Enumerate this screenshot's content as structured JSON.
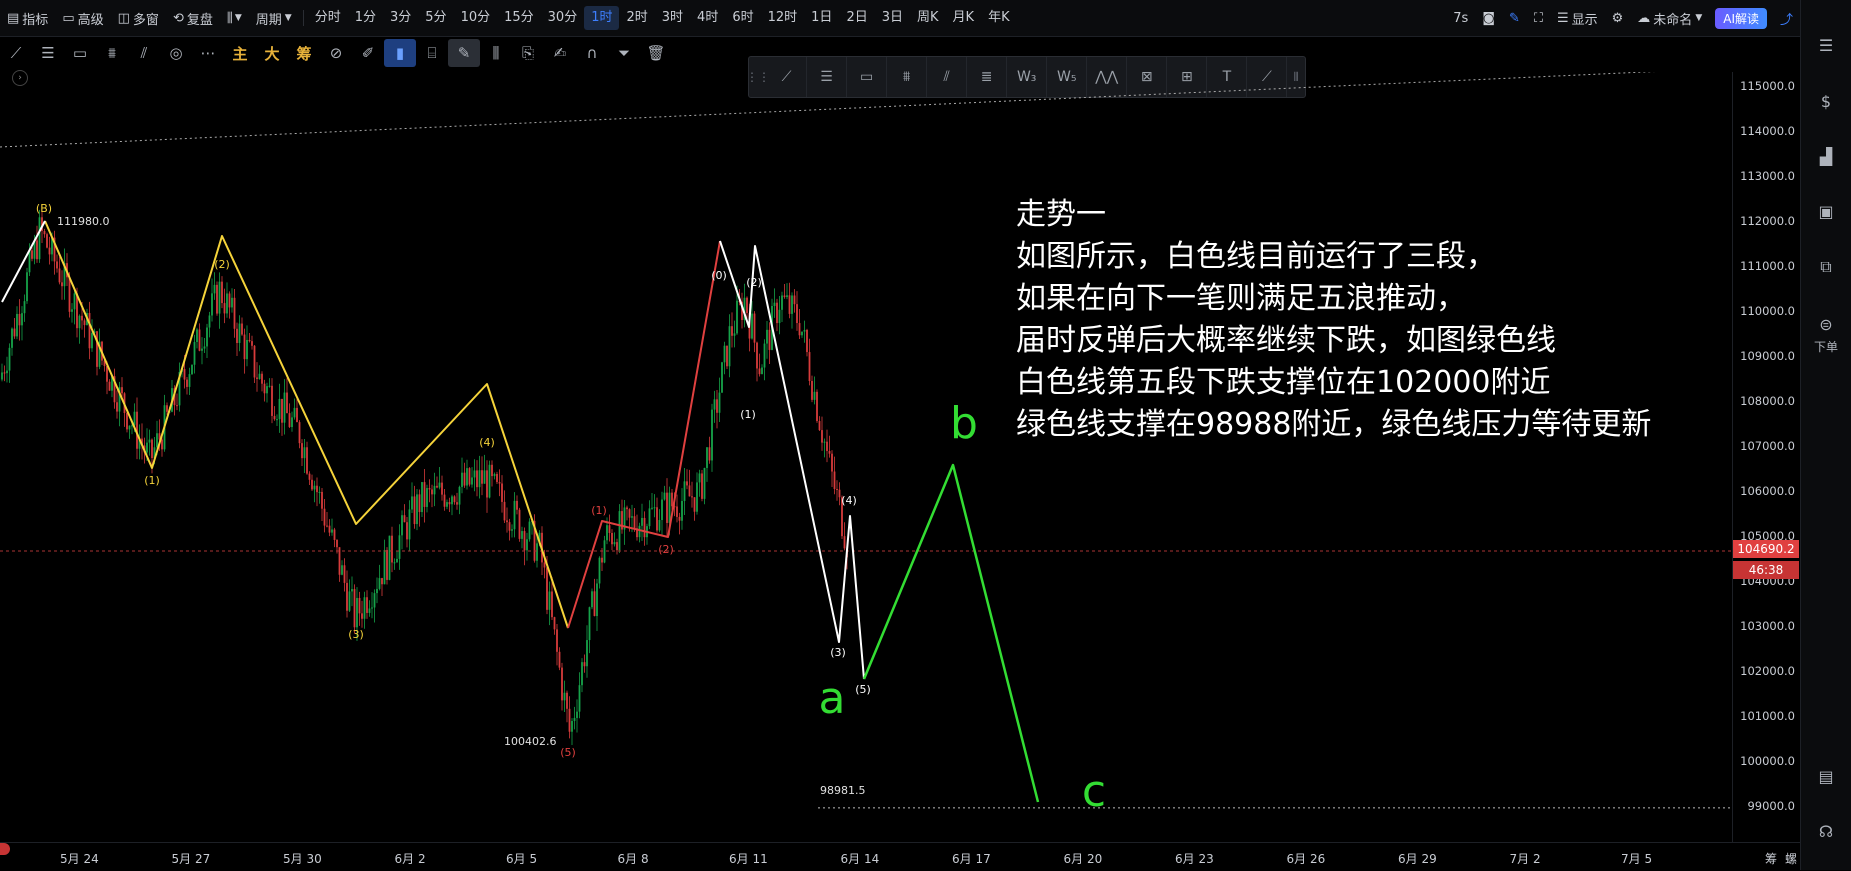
{
  "topbar": {
    "left_items": [
      {
        "label": "指标",
        "icon": "indicator-icon"
      },
      {
        "label": "高级",
        "icon": "advanced-icon"
      },
      {
        "label": "多窗",
        "icon": "multiwindow-icon"
      },
      {
        "label": "复盘",
        "icon": "replay-icon"
      },
      {
        "label": "周期",
        "icon": "chart-type-icon"
      }
    ],
    "periods": [
      "分时",
      "1分",
      "3分",
      "5分",
      "10分",
      "15分",
      "30分",
      "1时",
      "2时",
      "3时",
      "4时",
      "6时",
      "12时",
      "1日",
      "2日",
      "3日",
      "周K",
      "月K",
      "年K"
    ],
    "active_period": "1时",
    "right": {
      "countdown": "7s",
      "display_label": "显示",
      "workspace_label": "未命名",
      "ai_label": "AI解读"
    }
  },
  "toolbar2": {
    "cn_tools": [
      "主",
      "大",
      "筹"
    ]
  },
  "chart": {
    "price_ticks": [
      "115000.0",
      "114000.0",
      "113000.0",
      "112000.0",
      "111000.0",
      "110000.0",
      "109000.0",
      "108000.0",
      "107000.0",
      "106000.0",
      "105000.0",
      "104000.0",
      "103000.0",
      "102000.0",
      "101000.0",
      "100000.0",
      "99000.0"
    ],
    "current_price": "104690.2",
    "countdown_timer": "46:38",
    "date_labels": [
      "5月 24",
      "5月 27",
      "5月 30",
      "6月 2",
      "6月 5",
      "6月 8",
      "6月 11",
      "6月 14",
      "6月 17",
      "6月 20",
      "6月 23",
      "6月 26",
      "6月 29",
      "7月 2",
      "7月 5"
    ],
    "high_label": "111980.0",
    "low_label": "100402.6",
    "support_label": "98981.5",
    "yellow_wave_labels": [
      "(B)",
      "(1)",
      "(2)",
      "(3)",
      "(4)",
      "(5)"
    ],
    "red_wave_labels": [
      "(1)",
      "(2)"
    ],
    "white_wave_labels": [
      "(0)",
      "(1)",
      "(2)",
      "(3)",
      "(4)",
      "(5)"
    ],
    "green_labels": [
      "a",
      "b",
      "c"
    ],
    "axis_corner": [
      "筹",
      "螺"
    ]
  },
  "annotation": {
    "lines": [
      "走势一",
      "如图所示，白色线目前运行了三段，",
      "如果在向下一笔则满足五浪推动，",
      "届时反弹后大概率继续下跌，如图绿色线",
      "白色线第五段下跌支撑位在102000附近",
      "绿色线支撑在98988附近，绿色线压力等待更新"
    ]
  },
  "rightbar": {
    "order_label": "下单"
  },
  "colors": {
    "up": "#16a34a",
    "down": "#d83b3b",
    "yellow_wave": "#f5d33a",
    "white_wave": "#ffffff",
    "red_wave": "#e0403f",
    "green_wave": "#33dd33",
    "active": "#3d7fff"
  }
}
